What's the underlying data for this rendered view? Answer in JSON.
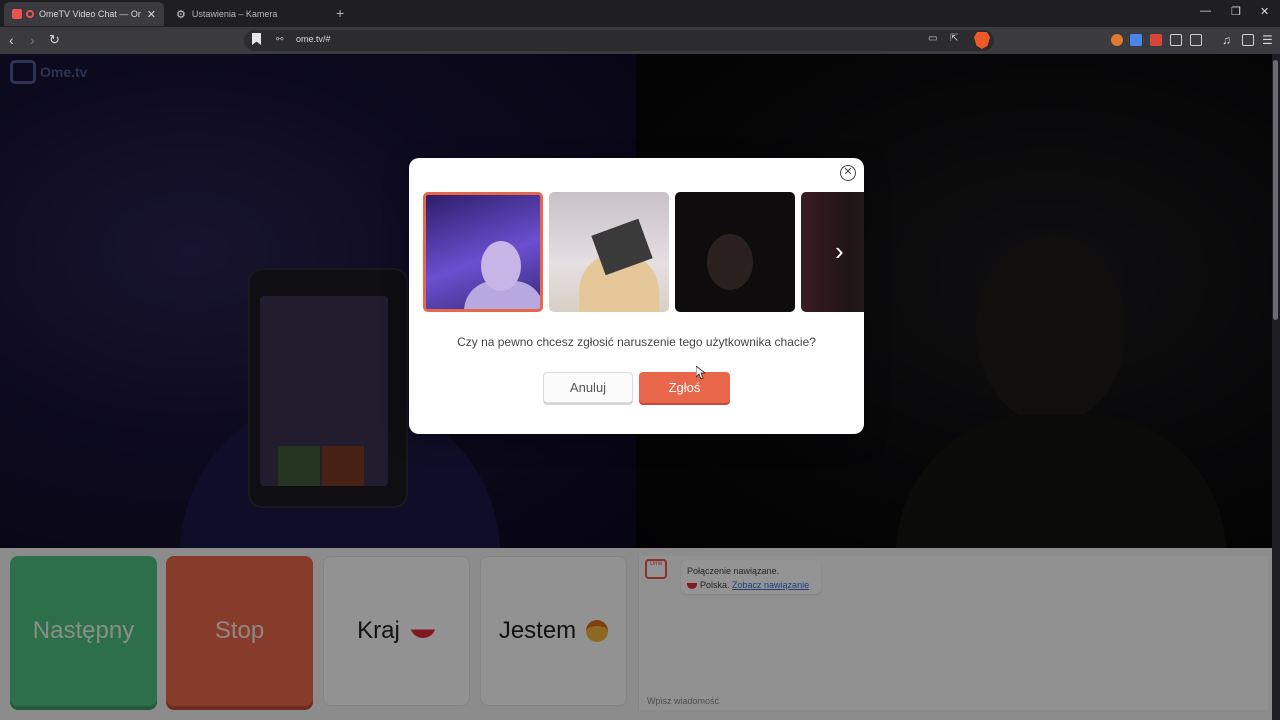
{
  "tabs": [
    {
      "title": "OmeTV Video Chat — Omegl",
      "active": true
    },
    {
      "title": "Ustawienia – Kamera",
      "active": false
    }
  ],
  "window_controls": {
    "minimize": "—",
    "restore": "❐",
    "close": "✕"
  },
  "new_tab": "+",
  "address_bar": {
    "url": "ome.tv/#"
  },
  "logo_text": "Ome.tv",
  "modal": {
    "close_glyph": "✕",
    "question": "Czy na pewno chcesz zgłosić naruszenie tego użytkownika chacie?",
    "cancel_label": "Anuluj",
    "report_label": "Zgłoś",
    "next_arrow": "›"
  },
  "controls": {
    "next_label": "Następny",
    "stop_label": "Stop",
    "country_label": "Kraj",
    "gender_label": "Jestem"
  },
  "chat": {
    "line1": "Połączenie nawiązane.",
    "country": "Polska.",
    "country_link": "Zobacz nawiązanie",
    "hint": "Wpisz wiadomość"
  },
  "colors": {
    "accent": "#e8664a",
    "next_green": "#4fbf7d"
  }
}
